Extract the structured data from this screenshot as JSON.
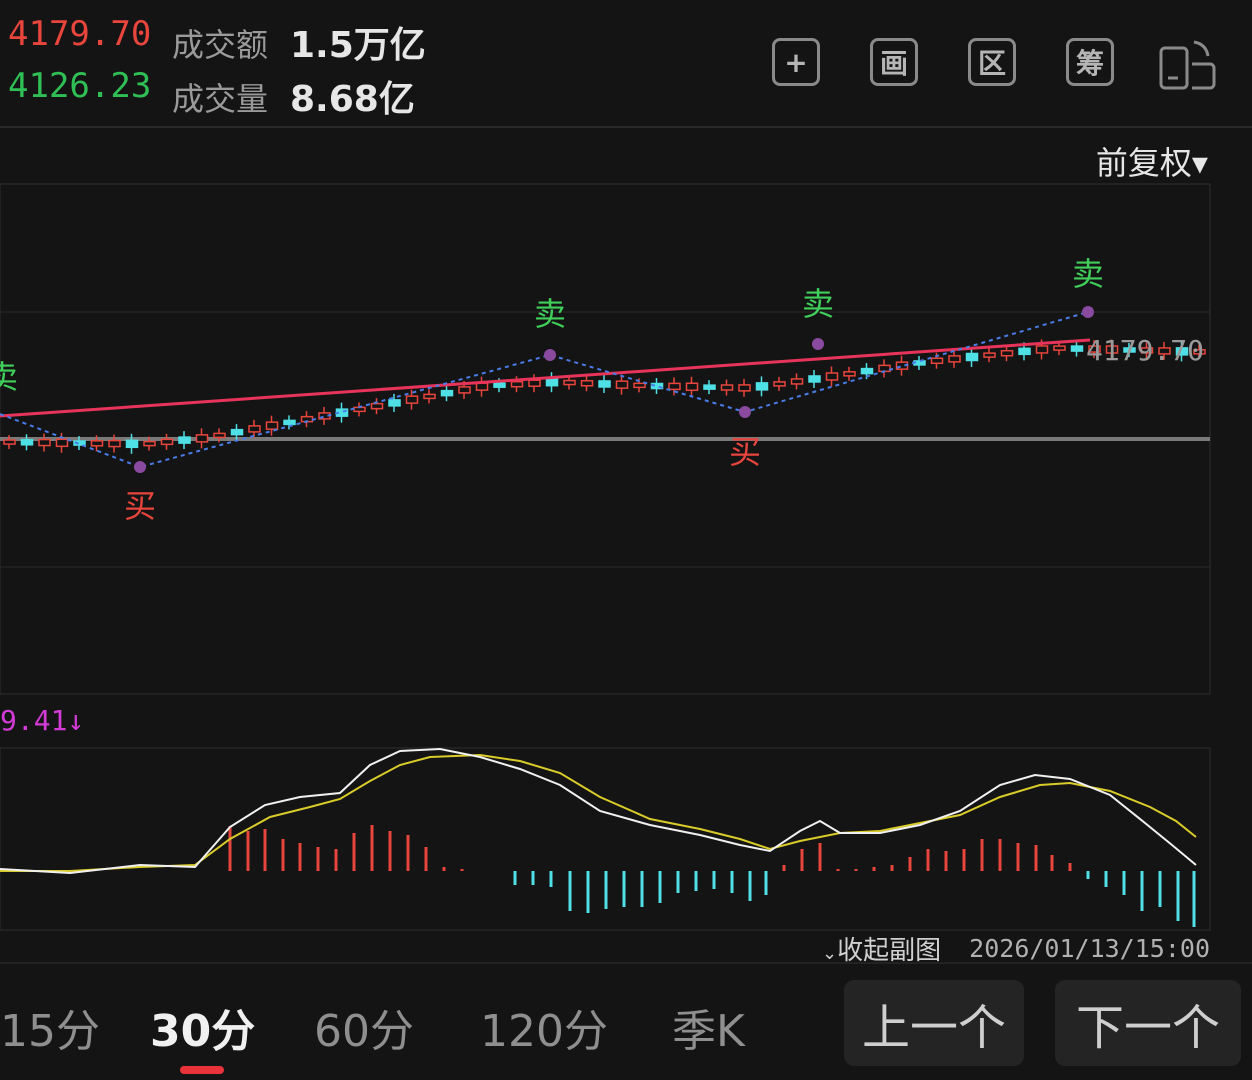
{
  "header": {
    "high_price": "4179.70",
    "low_price": "4126.23",
    "turnover_label": "成交额",
    "turnover_value": "1.5万亿",
    "volume_label": "成交量",
    "volume_value": "8.68亿"
  },
  "toolbar": {
    "buttons": [
      {
        "name": "add",
        "glyph": "+"
      },
      {
        "name": "draw",
        "glyph": "画"
      },
      {
        "name": "range",
        "glyph": "区"
      },
      {
        "name": "chip",
        "glyph": "筹"
      },
      {
        "name": "rotate",
        "glyph": ""
      }
    ]
  },
  "chart": {
    "adjust_label": "前复权▾",
    "last_price_label": "4179.70",
    "signals": {
      "sell": "卖",
      "buy": "买"
    },
    "colors": {
      "up": "#e8453c",
      "down": "#4fe0e6",
      "trend": "#e8345a",
      "zigzag": "#4a7ce8",
      "dif": "#f0f0f0",
      "dea": "#d9cc2a"
    }
  },
  "macd": {
    "value_label": "9.41↓",
    "collapse_label": "收起副图",
    "timestamp": "2026/01/13/15:00"
  },
  "periods": [
    "15分",
    "30分",
    "60分",
    "120分",
    "季K"
  ],
  "active_period": "30分",
  "nav": {
    "prev": "上一个",
    "next": "下一个"
  }
}
